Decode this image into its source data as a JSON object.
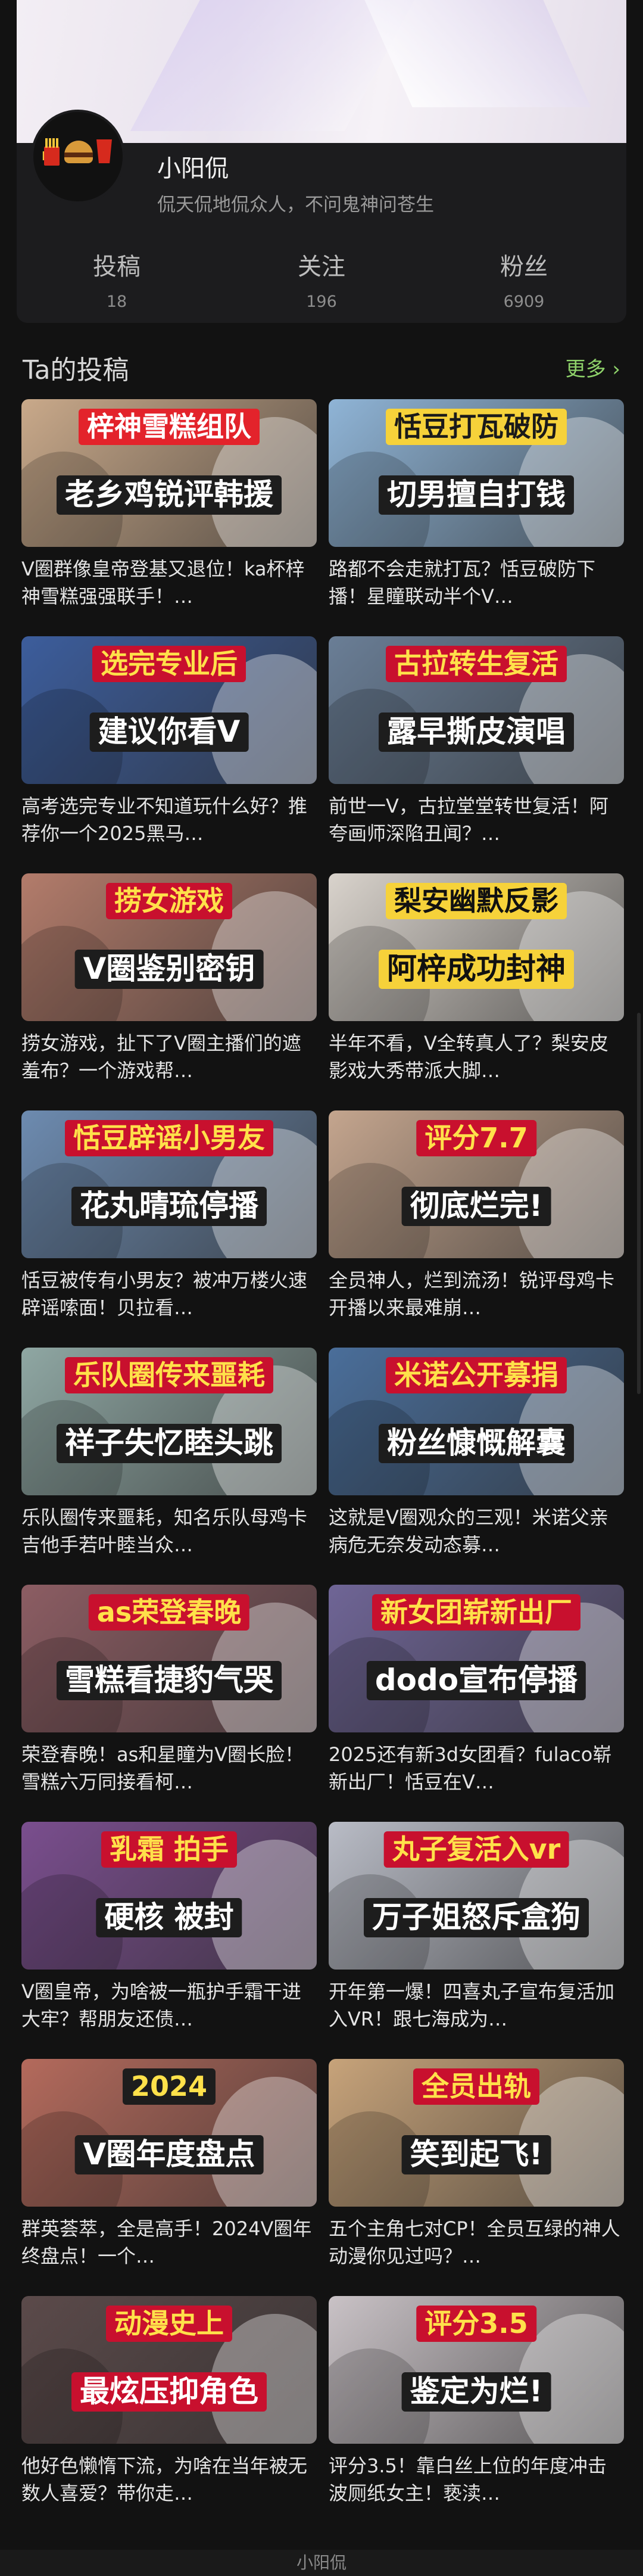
{
  "profile": {
    "username": "小阳侃",
    "bio": "侃天侃地侃众人，不问鬼神问苍生",
    "stats": [
      {
        "label": "投稿",
        "value": "18"
      },
      {
        "label": "关注",
        "value": "196"
      },
      {
        "label": "粉丝",
        "value": "6909"
      }
    ]
  },
  "section": {
    "title": "Ta的投稿",
    "more": "更多 ›"
  },
  "videos": [
    {
      "cap1": "梓神雪糕组队",
      "cap2": "老乡鸡锐评韩援",
      "desc": "V圈群像皇帝登基又退位！ka杯梓神雪糕强强联手！…",
      "bg": "#c9a98a",
      "c1": "#ffffff",
      "c1bg": "#e3232b",
      "c2": "#ffffff",
      "c2bg": "#1d1d1d"
    },
    {
      "cap1": "恬豆打瓦破防",
      "cap2": "切男擅自打钱",
      "desc": "路都不会走就打瓦？恬豆破防下播！星瞳联动半个V…",
      "bg": "#8fb4d6",
      "c1": "#1a1a1a",
      "c1bg": "#f6d23a",
      "c2": "#ffffff",
      "c2bg": "#1d1d1d"
    },
    {
      "cap1": "选完专业后",
      "cap2": "建议你看V",
      "desc": "高考选完专业不知道玩什么好？推荐你一个2025黑马…",
      "bg": "#3c5d9c",
      "c1": "#ffe14a",
      "c1bg": "#c8102e",
      "c2": "#ffffff",
      "c2bg": "#1d1d1d"
    },
    {
      "cap1": "古拉转生复活",
      "cap2": "露早撕皮演唱",
      "desc": "前世一V，古拉堂堂转世复活！阿夸画师深陷丑闻？…",
      "bg": "#6a7e96",
      "c1": "#ffe14a",
      "c1bg": "#c8102e",
      "c2": "#ffffff",
      "c2bg": "#1d1d1d"
    },
    {
      "cap1": "捞女游戏",
      "cap2": "V圈鉴别密钥",
      "desc": "捞女游戏，扯下了V圈主播们的遮羞布？一个游戏帮…",
      "bg": "#b37c6b",
      "c1": "#ffe14a",
      "c1bg": "#c8102e",
      "c2": "#ffffff",
      "c2bg": "#1d1d1d"
    },
    {
      "cap1": "梨安幽默反影",
      "cap2": "阿梓成功封神",
      "desc": "半年不看，V全转真人了？梨安皮影戏大秀带派大脚…",
      "bg": "#d9d3cc",
      "c1": "#111111",
      "c1bg": "#f6d23a",
      "c2": "#111111",
      "c2bg": "#f6d23a"
    },
    {
      "cap1": "恬豆辟谣小男友",
      "cap2": "花丸晴琉停播",
      "desc": "恬豆被传有小男友？被冲万楼火速辟谣嗦面！贝拉看…",
      "bg": "#6d8bb0",
      "c1": "#ffe14a",
      "c1bg": "#c8102e",
      "c2": "#ffffff",
      "c2bg": "#1d1d1d"
    },
    {
      "cap1": "评分7.7",
      "cap2": "彻底烂完!",
      "desc": "全员神人，烂到流汤！锐评母鸡卡开播以来最难崩…",
      "bg": "#c4a58e",
      "c1": "#ffe14a",
      "c1bg": "#c8102e",
      "c2": "#ffffff",
      "c2bg": "#1d1d1d"
    },
    {
      "cap1": "乐队圈传来噩耗",
      "cap2": "祥子失忆睦头跳",
      "desc": "乐队圈传来噩耗，知名乐队母鸡卡吉他手若叶睦当众…",
      "bg": "#8fa7a3",
      "c1": "#ffe14a",
      "c1bg": "#c8102e",
      "c2": "#ffffff",
      "c2bg": "#1d1d1d"
    },
    {
      "cap1": "米诺公开募捐",
      "cap2": "粉丝慷慨解囊",
      "desc": "这就是V圈观众的三观！米诺父亲病危无奈发动态募…",
      "bg": "#4a6e9a",
      "c1": "#ffe14a",
      "c1bg": "#c8102e",
      "c2": "#ffffff",
      "c2bg": "#1d1d1d"
    },
    {
      "cap1": "as荣登春晚",
      "cap2": "雪糕看捷豹气哭",
      "desc": "荣登春晚！as和星瞳为V圈长脸！雪糕六万同接看柯…",
      "bg": "#8c5d63",
      "c1": "#ffe14a",
      "c1bg": "#c8102e",
      "c2": "#ffffff",
      "c2bg": "#1d1d1d"
    },
    {
      "cap1": "新女团崭新出厂",
      "cap2": "dodo宣布停播",
      "desc": "2025还有新3d女团看？fulaco崭新出厂！恬豆在V…",
      "bg": "#6f6596",
      "c1": "#ffe14a",
      "c1bg": "#c8102e",
      "c2": "#ffffff",
      "c2bg": "#1d1d1d"
    },
    {
      "cap1": "乳霜 拍手",
      "cap2": "硬核 被封",
      "desc": "V圈皇帝，为啥被一瓶护手霜干进大牢？帮朋友还债…",
      "bg": "#7a4e8e",
      "c1": "#ffe14a",
      "c1bg": "#c8102e",
      "c2": "#ffffff",
      "c2bg": "#1d1d1d"
    },
    {
      "cap1": "丸子复活入vr",
      "cap2": "万子姐怒斥盒狗",
      "desc": "开年第一爆！四喜丸子宣布复活加入VR！跟七海成为…",
      "bg": "#b9bcc6",
      "c1": "#ffe14a",
      "c1bg": "#c8102e",
      "c2": "#ffffff",
      "c2bg": "#1d1d1d"
    },
    {
      "cap1": "2024",
      "cap2": "V圈年度盘点",
      "desc": "群英荟萃，全是高手！2024V圈年终盘点！一个…",
      "bg": "#b46a5c",
      "c1": "#ffe14a",
      "c1bg": "#1d1d1d",
      "c2": "#ffffff",
      "c2bg": "#1d1d1d"
    },
    {
      "cap1": "全员出轨",
      "cap2": "笑到起飞!",
      "desc": "五个主角七对CP！全员互绿的神人动漫你见过吗？…",
      "bg": "#c7a37a",
      "c1": "#ffe14a",
      "c1bg": "#c8102e",
      "c2": "#ffffff",
      "c2bg": "#1d1d1d"
    },
    {
      "cap1": "动漫史上",
      "cap2": "最炫压抑角色",
      "desc": "他好色懒惰下流，为啥在当年被无数人喜爱？带你走…",
      "bg": "#5b4a4a",
      "c1": "#ffe14a",
      "c1bg": "#c8102e",
      "c2": "#ffffff",
      "c2bg": "#c8102e"
    },
    {
      "cap1": "评分3.5",
      "cap2": "鉴定为烂!",
      "desc": "评分3.5！靠白丝上位的年度冲击波厕纸女主！亵渎…",
      "bg": "#c9c2c6",
      "c1": "#ffe14a",
      "c1bg": "#c8102e",
      "c2": "#ffffff",
      "c2bg": "#1d1d1d"
    }
  ],
  "bottom": {
    "label": "小阳侃"
  }
}
